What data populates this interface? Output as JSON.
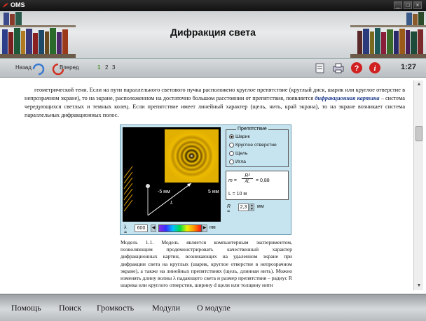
{
  "window": {
    "app_name": "OMS",
    "controls": [
      "minimize-icon",
      "restore-icon",
      "close-icon"
    ]
  },
  "header": {
    "title": "Дифракция света"
  },
  "toolbar": {
    "back_label": "Назад",
    "forward_label": "Вперед",
    "pages": [
      "1",
      "2",
      "3"
    ],
    "active_page": "1",
    "tools": [
      "notepad-icon",
      "print-icon",
      "help-icon",
      "info-icon"
    ],
    "clock": "1:27"
  },
  "content": {
    "intro_line1": "геометрической тени. Если на пути параллельного светового пучка расположено круглое препятствие (круглый диск, шарик или круглое отверстие в непрозрачном экране), то на экране, расположенном на достаточно большом расстоянии от препятствия, появляется ",
    "intro_highlight": "дифракционная картина",
    "intro_line2": " – система чередующихся светлых и темных колец. Если препятствие имеет линейный характер (щель, нить, край экрана), то на экране возникает система параллельных дифракционных полос.",
    "caption": "Модель 1.1. Модель является компьютерным экспериментом, позволяющим продемонстрировать качественный характер дифракционных картин, возникающих на удаленном экране при дифракции света на круглых (шарик, круглое отверстие в непрозрачном экране), а также на линейных препятствиях (щель, длинная нить). Можно изменять длину волны λ падающего света и размер препятствия – радиус R шарика или круглого отверстия, ширину d щели или толщину нити"
  },
  "simulation": {
    "obstacle_legend": "Препятствие",
    "obstacle_options": [
      "Шарик",
      "Круглое отверстие",
      "Щель",
      "Игла"
    ],
    "obstacle_selected": "Шарик",
    "screen_left_label": "-5 мм",
    "screen_right_label": "5 мм",
    "distance_label": "L",
    "lambda_symbol": "λ =",
    "lambda_value": "600",
    "lambda_unit": "нм",
    "formula_m": "m =",
    "formula_num": "R²",
    "formula_den": "λL",
    "formula_value": "= 0,88",
    "formula_L": "L = 10 м",
    "r_symbol": "R =",
    "r_value": "2,3",
    "r_unit": "мм",
    "colors": {
      "pattern_gold": "#e8b000",
      "panel_bg": "#c6e4ef"
    }
  },
  "bottom_menu": {
    "items": [
      "Помощь",
      "Поиск",
      "Громкость",
      "Модули",
      "О модуле"
    ]
  }
}
